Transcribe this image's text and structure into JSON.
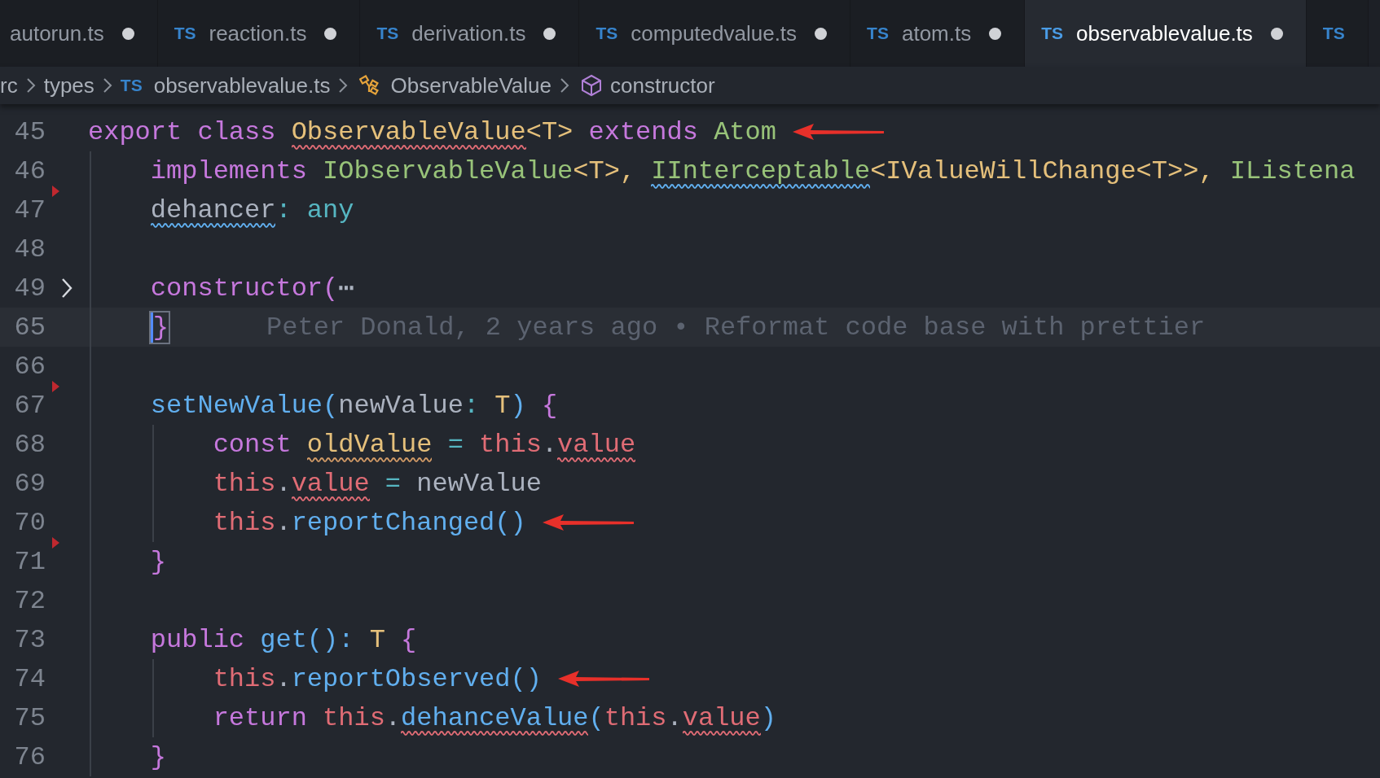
{
  "tabs": [
    {
      "label": "autorun.ts",
      "dirty": true,
      "selected": false
    },
    {
      "badge": "TS",
      "label": "reaction.ts",
      "dirty": true,
      "selected": false
    },
    {
      "badge": "TS",
      "label": "derivation.ts",
      "dirty": true,
      "selected": false
    },
    {
      "badge": "TS",
      "label": "computedvalue.ts",
      "dirty": true,
      "selected": false
    },
    {
      "badge": "TS",
      "label": "atom.ts",
      "dirty": true,
      "selected": false
    },
    {
      "badge": "TS",
      "label": "observablevalue.ts",
      "dirty": true,
      "selected": true
    },
    {
      "badge": "TS",
      "selected": false
    }
  ],
  "breadcrumbs": [
    {
      "kind": "folder",
      "text": "rc"
    },
    {
      "kind": "folder",
      "text": "types"
    },
    {
      "kind": "file",
      "badge": "TS",
      "text": "observablevalue.ts"
    },
    {
      "kind": "class",
      "text": "ObservableValue"
    },
    {
      "kind": "method",
      "text": "constructor"
    }
  ],
  "lines": [
    {
      "number": "45",
      "arrow": true,
      "tokens": [
        {
          "text": "export class",
          "kind": "kw"
        },
        {
          "text": "ObservableValue",
          "kind": "type",
          "error": true
        },
        {
          "text": "<T>",
          "kind": "typeparam"
        },
        {
          "text": "extends",
          "kind": "kw"
        },
        {
          "text": "Atom",
          "kind": "cls"
        }
      ]
    },
    {
      "number": "46",
      "tokens": [
        {
          "text": "    implements",
          "kind": "kw"
        },
        {
          "text": "IObservableValue",
          "kind": "cls"
        },
        {
          "text": "<T>,",
          "kind": "typeparam"
        },
        {
          "text": "IInterceptable",
          "kind": "cls",
          "info": true
        },
        {
          "text": "<IValueWillChange<T>>,",
          "kind": "typeparam"
        },
        {
          "text": "IListena",
          "kind": "cls"
        }
      ]
    },
    {
      "number": "47",
      "deleted_marker": true,
      "tokens": [
        {
          "text": "    dehancer",
          "kind": "plain",
          "info": true
        },
        {
          "text": ":",
          "kind": "op"
        },
        {
          "text": "any",
          "kind": "builtin"
        }
      ]
    },
    {
      "number": "48"
    },
    {
      "number": "49",
      "folded": true,
      "tokens": [
        {
          "text": "    constructor(",
          "kind": "kw"
        },
        {
          "text": "⋯",
          "kind": "fold"
        }
      ]
    },
    {
      "number": "65",
      "current": true,
      "blame": "Peter Donald, 2 years ago • Reformat code base with prettier",
      "tokens": [
        {
          "text": "    }",
          "kind": "bracket",
          "cursor": true
        }
      ]
    },
    {
      "number": "66"
    },
    {
      "number": "67",
      "deleted_marker": true,
      "tokens": [
        {
          "text": "    setNewValue(",
          "kind": "fn"
        },
        {
          "text": "newValue",
          "kind": "plain"
        },
        {
          "text": ":",
          "kind": "op"
        },
        {
          "text": "T",
          "kind": "type"
        },
        {
          "text": ")",
          "kind": "fn"
        },
        {
          "text": "{",
          "kind": "bracket"
        }
      ]
    },
    {
      "number": "68",
      "tokens": [
        {
          "text": "        const",
          "kind": "kw"
        },
        {
          "text": "oldValue",
          "kind": "type",
          "warning": true
        },
        {
          "text": "=",
          "kind": "op"
        },
        {
          "text": "this",
          "kind": "this"
        },
        {
          "text": ".",
          "kind": "plain"
        },
        {
          "text": "value",
          "kind": "this",
          "error": true
        }
      ]
    },
    {
      "number": "69",
      "tokens": [
        {
          "text": "        this",
          "kind": "this"
        },
        {
          "text": ".",
          "kind": "plain"
        },
        {
          "text": "value",
          "kind": "this",
          "error": true
        },
        {
          "text": "=",
          "kind": "op"
        },
        {
          "text": "newValue",
          "kind": "plain"
        }
      ]
    },
    {
      "number": "70",
      "arrow": true,
      "tokens": [
        {
          "text": "        this",
          "kind": "this"
        },
        {
          "text": ".",
          "kind": "plain"
        },
        {
          "text": "reportChanged()",
          "kind": "fn"
        }
      ]
    },
    {
      "number": "71",
      "deleted_marker": true,
      "tokens": [
        {
          "text": "    }",
          "kind": "bracket"
        }
      ]
    },
    {
      "number": "72"
    },
    {
      "number": "73",
      "tokens": [
        {
          "text": "    public",
          "kind": "kw"
        },
        {
          "text": "get():",
          "kind": "fn"
        },
        {
          "text": "T",
          "kind": "type"
        },
        {
          "text": "{",
          "kind": "bracket"
        }
      ]
    },
    {
      "number": "74",
      "arrow": true,
      "tokens": [
        {
          "text": "        this",
          "kind": "this"
        },
        {
          "text": ".",
          "kind": "plain"
        },
        {
          "text": "reportObserved()",
          "kind": "fn"
        }
      ]
    },
    {
      "number": "75",
      "tokens": [
        {
          "text": "        return",
          "kind": "kw"
        },
        {
          "text": "this",
          "kind": "this"
        },
        {
          "text": ".",
          "kind": "plain"
        },
        {
          "text": "dehanceValue",
          "kind": "fn",
          "error": true
        },
        {
          "text": "(",
          "kind": "fn"
        },
        {
          "text": "this",
          "kind": "this"
        },
        {
          "text": ".",
          "kind": "plain"
        },
        {
          "text": "value",
          "kind": "this",
          "error": true
        },
        {
          "text": ")",
          "kind": "fn"
        }
      ]
    },
    {
      "number": "76",
      "tokens": [
        {
          "text": "    }",
          "kind": "bracket"
        }
      ]
    }
  ]
}
